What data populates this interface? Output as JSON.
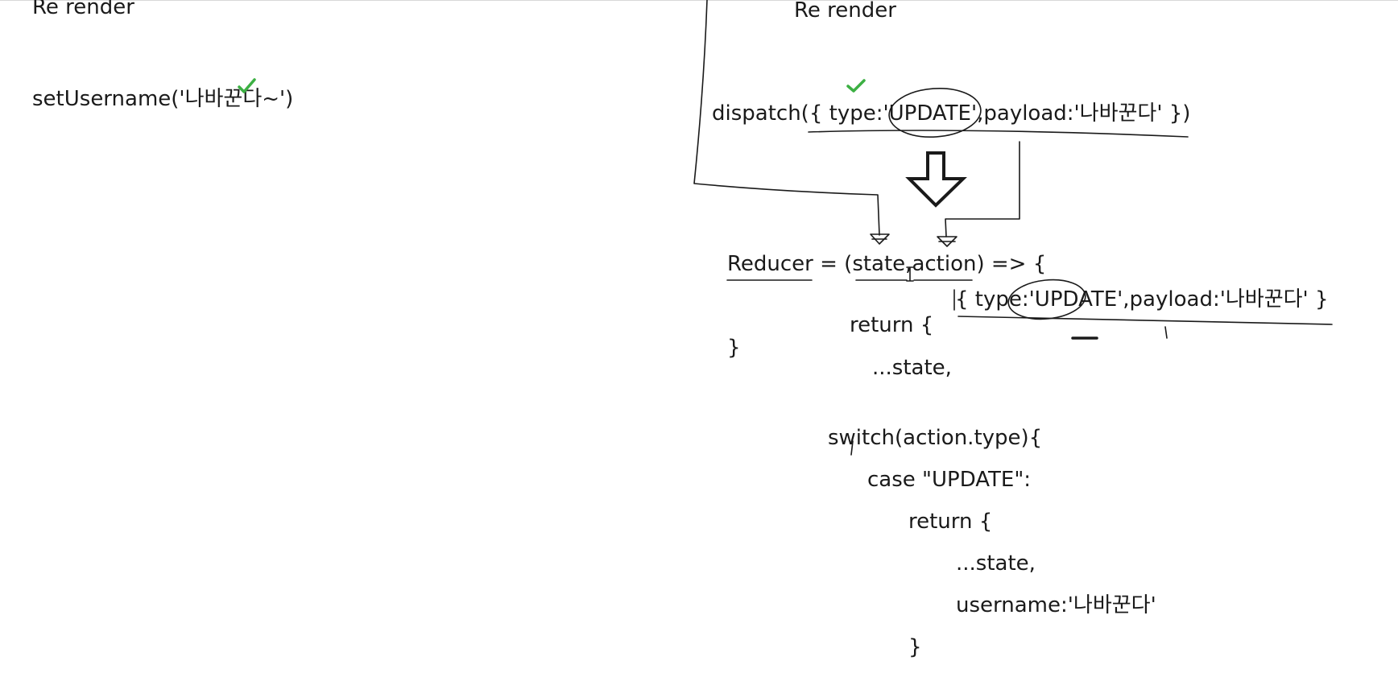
{
  "left_panel": {
    "heading": "Re render",
    "call": "setUsername('나바꾼다~')"
  },
  "right_panel": {
    "heading": "Re render",
    "dispatch_call": "dispatch({ type:'UPDATE',payload:'나바꾼다' })",
    "reducer": {
      "signature": "Reducer = (state,action) => {",
      "action_note": "{ type:'UPDATE',payload:'나바꾼다' }",
      "return_open": "return {",
      "close_brace": "}",
      "spread_state": "...state,",
      "switch_line": "switch(action.type){",
      "case_line": "case \"UPDATE\":",
      "inner_return_open": "return {",
      "inner_spread_state": "...state,",
      "username_line": "username:'나바꾼다'",
      "inner_close_brace": "}"
    }
  },
  "colors": {
    "ink": "#1a1a1a",
    "check": "#3cb043"
  },
  "icons": [
    "check-mark-icon",
    "down-arrow-icon"
  ]
}
